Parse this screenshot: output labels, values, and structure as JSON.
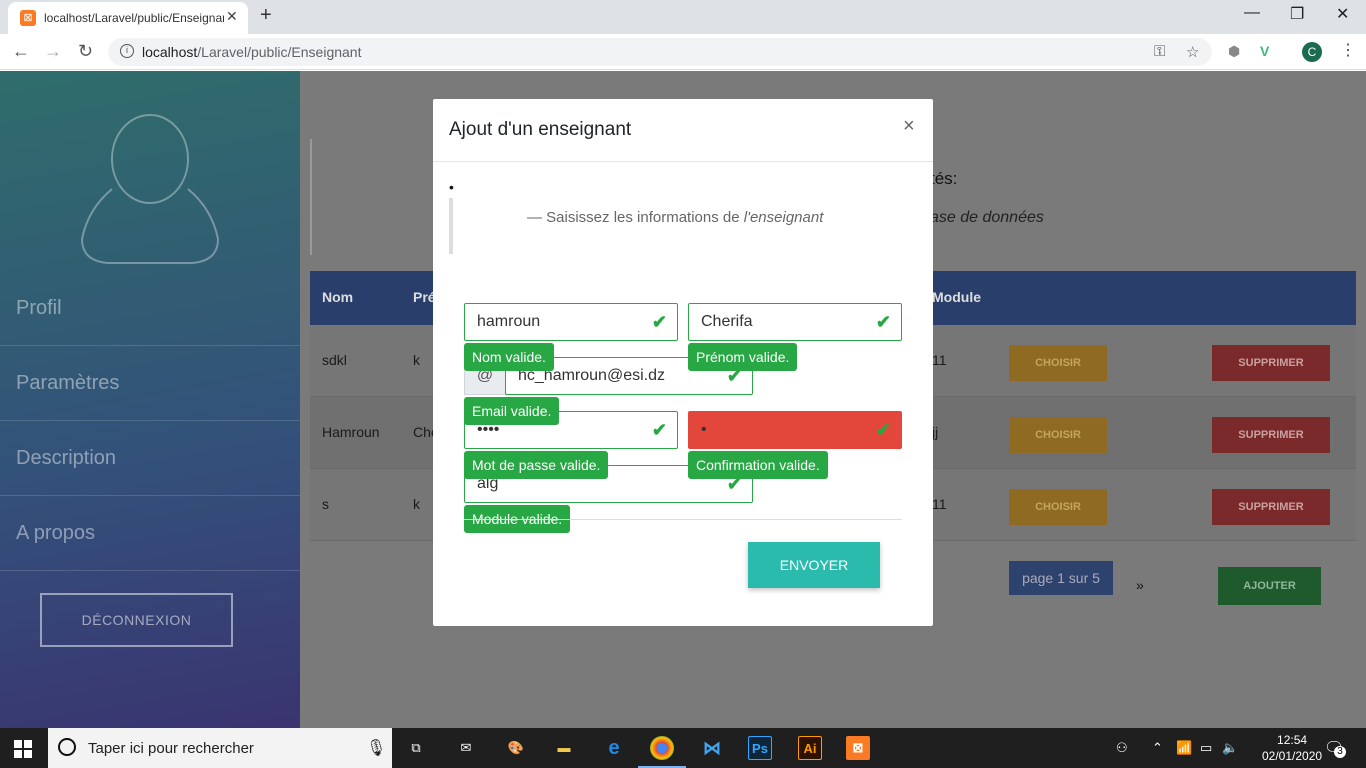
{
  "browser": {
    "tab_title": "localhost/Laravel/public/Enseignant",
    "url_host": "localhost",
    "url_path": "/Laravel/public/Enseignant",
    "profile_initial": "C"
  },
  "sidebar": {
    "items": [
      {
        "label": "Profil"
      },
      {
        "label": "Paramètres"
      },
      {
        "label": "Description"
      },
      {
        "label": "A propos"
      }
    ],
    "logout_label": "DÉCONNEXION"
  },
  "main": {
    "heading_partial": "tés:",
    "subtitle_partial": "ase de données",
    "columns": {
      "nom": "Nom",
      "prenom": "Pré",
      "module": "Module"
    },
    "rows": [
      {
        "nom": "sdkl",
        "prenom": "k",
        "module": "11"
      },
      {
        "nom": "Hamroun",
        "prenom": "Che",
        "module": "jj"
      },
      {
        "nom": "s",
        "prenom": "k",
        "module": "11"
      }
    ],
    "choose_label": "CHOISIR",
    "delete_label": "SUPPRIMER",
    "pagination": "page 1 sur 5",
    "next_label": "»",
    "add_label": "AJOUTER"
  },
  "modal": {
    "title": "Ajout d'un enseignant",
    "close_label": "×",
    "bullet": "•",
    "quote_prefix": "— Saisissez les informations de ",
    "quote_emph": "l'enseignant",
    "fields": {
      "nom": "hamroun",
      "prenom": "Cherifa",
      "email_prefix": "@",
      "email": "hc_hamroun@esi.dz",
      "password": "••••",
      "confirmation": "•",
      "module": "alg"
    },
    "tips": {
      "nom": "Nom valide.",
      "prenom": "Prénom valide.",
      "email": "Email valide.",
      "password": "Mot de passe valide.",
      "confirmation": "Confirmation valide.",
      "module": "Module valide."
    },
    "submit_label": "ENVOYER"
  },
  "taskbar": {
    "search_placeholder": "Taper ici pour rechercher",
    "time": "12:54",
    "date": "02/01/2020",
    "notification_count": "3"
  },
  "colors": {
    "valid_green": "#28a745",
    "invalid_red": "#e3463a",
    "send_teal": "#2bbbad"
  }
}
